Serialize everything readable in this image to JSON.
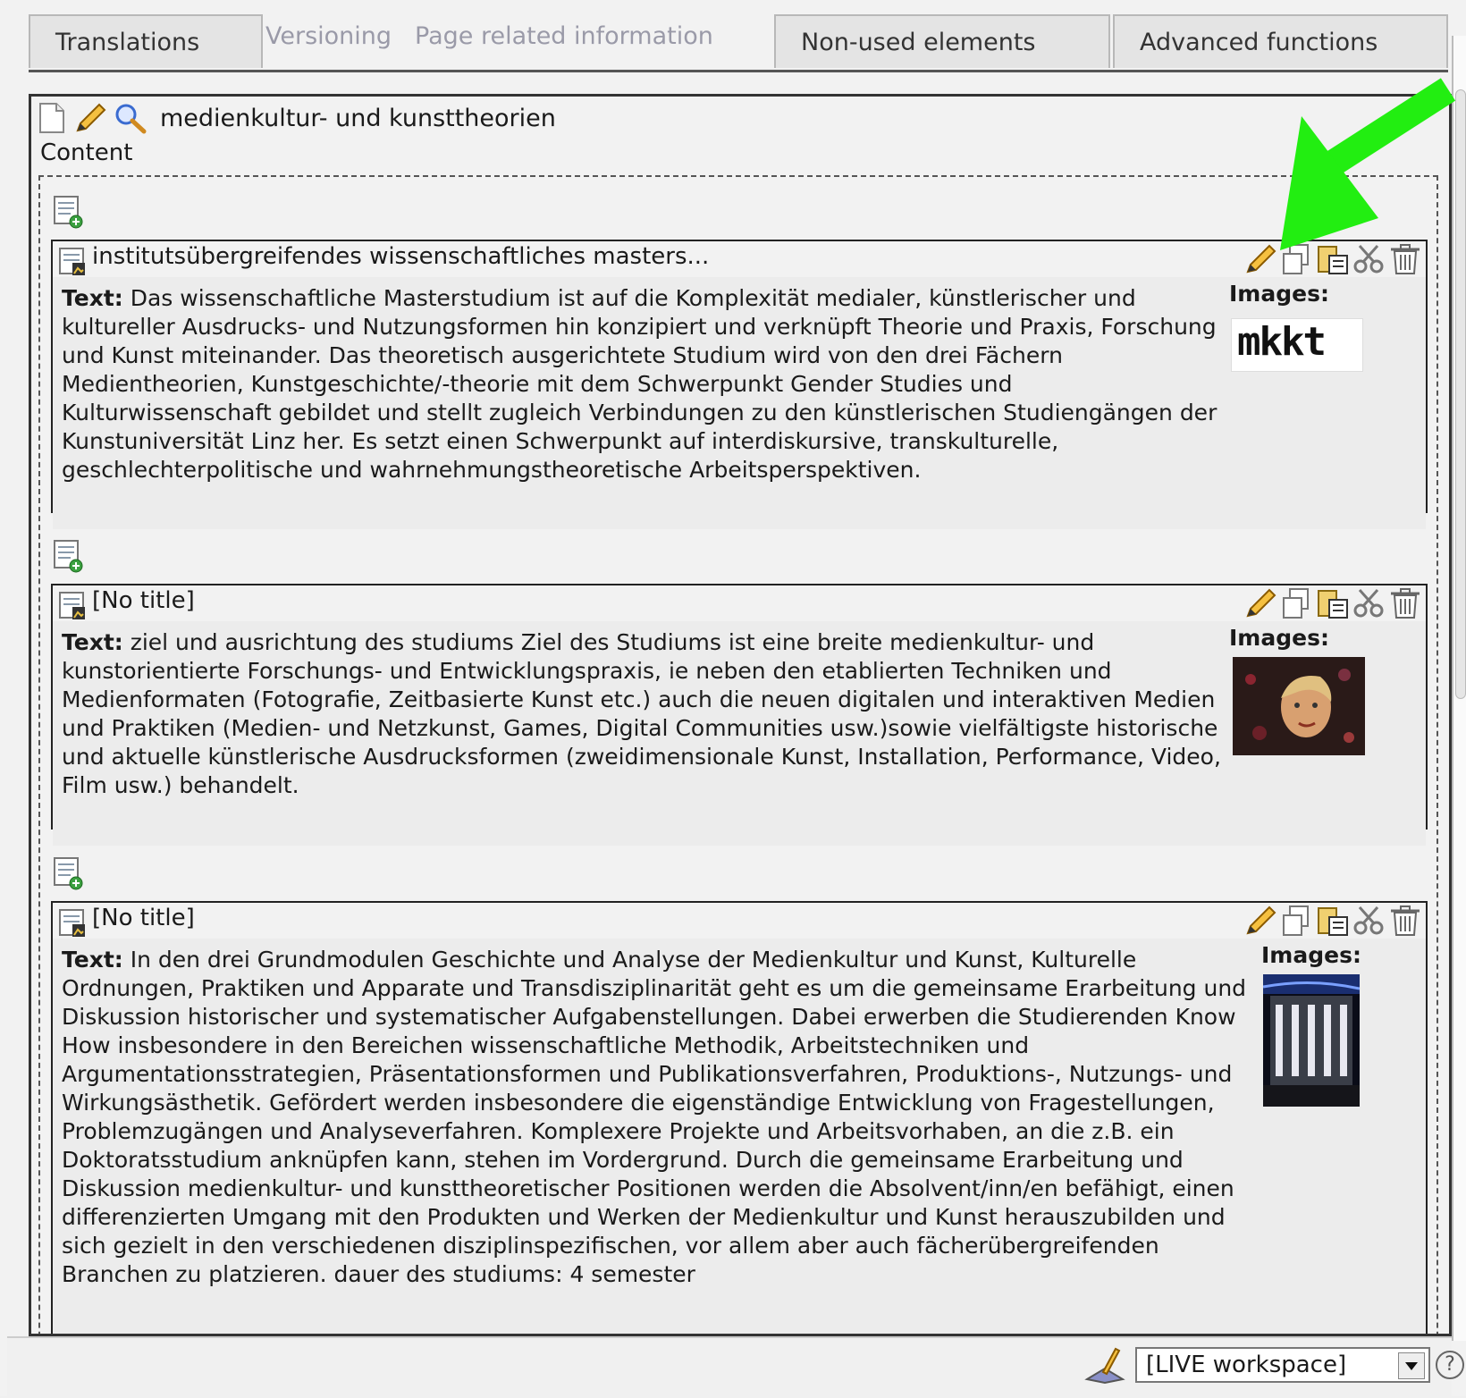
{
  "tabs": [
    {
      "label": "Translations"
    },
    {
      "label": "Versioning"
    },
    {
      "label": "Page related information"
    },
    {
      "label": "Non-used elements"
    },
    {
      "label": "Advanced functions"
    }
  ],
  "page": {
    "title": "medienkultur- und kunsttheorien",
    "content_label": "Content",
    "header_icons": [
      "page-icon",
      "pencil-icon",
      "magnifier-icon"
    ]
  },
  "elements": [
    {
      "title": "institutsübergreifendes wissenschaftliches masters...",
      "text_label": "Text:",
      "text": "Das wissenschaftliche Masterstudium ist auf die Komplexität medialer, künstlerischer und kultureller Ausdrucks- und Nutzungsformen hin konzipiert und verknüpft Theorie und Praxis, Forschung und Kunst miteinander. Das theoretisch ausgerichtete Studium wird von den drei Fächern Medientheorien, Kunstgeschichte/-theorie mit dem Schwerpunkt Gender Studies und Kulturwissenschaft gebildet und stellt zugleich Verbindungen zu den künstlerischen Studiengängen der Kunstuniversität Linz her. Es setzt einen Schwerpunkt auf interdiskursive, transkulturelle, geschlechterpolitische und wahrnehmungstheoretische Arbeitsperspektiven.",
      "images_label": "Images:",
      "image_logo_text": "mkkt"
    },
    {
      "title": "[No title]",
      "text_label": "Text:",
      "text": "ziel und ausrichtung des studiums Ziel des Studiums ist eine breite medienkultur- und kunstorientierte Forschungs- und Entwicklungspraxis, ie neben den etablierten Techniken und Medienformaten (Fotografie, Zeitbasierte Kunst etc.) auch die neuen digitalen und interaktiven Medien und Praktiken (Medien- und Netzkunst, Games, Digital Communities usw.)sowie vielfältigste historische und aktuelle künstlerische Ausdrucksformen (zweidimensionale Kunst, Installation, Performance, Video, Film usw.) behandelt.",
      "images_label": "Images:"
    },
    {
      "title": "[No title]",
      "text_label": "Text:",
      "text": "In den drei Grundmodulen Geschichte und Analyse der Medienkultur und Kunst, Kulturelle Ordnungen, Praktiken und Apparate und Transdisziplinarität geht es um die gemeinsame Erarbeitung und Diskussion historischer und systematischer Aufgabenstellungen. Dabei erwerben die Studierenden Know How insbesondere in den Bereichen wissenschaftliche Methodik, Arbeitstechniken und Argumentationsstrategien, Präsentationsformen und Publikationsverfahren, Produktions-, Nutzungs- und Wirkungsästhetik. Gefördert werden insbesondere die eigenständige Entwicklung von Fragestellungen, Problemzugängen und Analyseverfahren. Komplexere Projekte und Arbeitsvorhaben, an die z.B. ein Doktoratsstudium anknüpfen kann, stehen im Vordergrund. Durch die gemeinsame Erarbeitung und Diskussion medienkultur- und kunsttheoretischer Positionen werden die Absolvent/inn/en befähigt, einen differenzierten Umgang mit den Produkten und Werken der Medienkultur und Kunst herauszubilden und sich gezielt in den verschiedenen disziplinspezifischen, vor allem aber auch fächerübergreifenden Branchen zu platzieren. dauer des studiums: 4 semester",
      "images_label": "Images:"
    }
  ],
  "element_tool_icons": [
    "pencil-icon",
    "copy-icon",
    "paste-icon",
    "cut-icon",
    "trash-icon"
  ],
  "workspace": {
    "selected": "[LIVE workspace]"
  },
  "help_label": "?",
  "colors": {
    "arrow": "#22ee11",
    "border": "#222222",
    "tab_dim_text": "#9a9aa8"
  }
}
